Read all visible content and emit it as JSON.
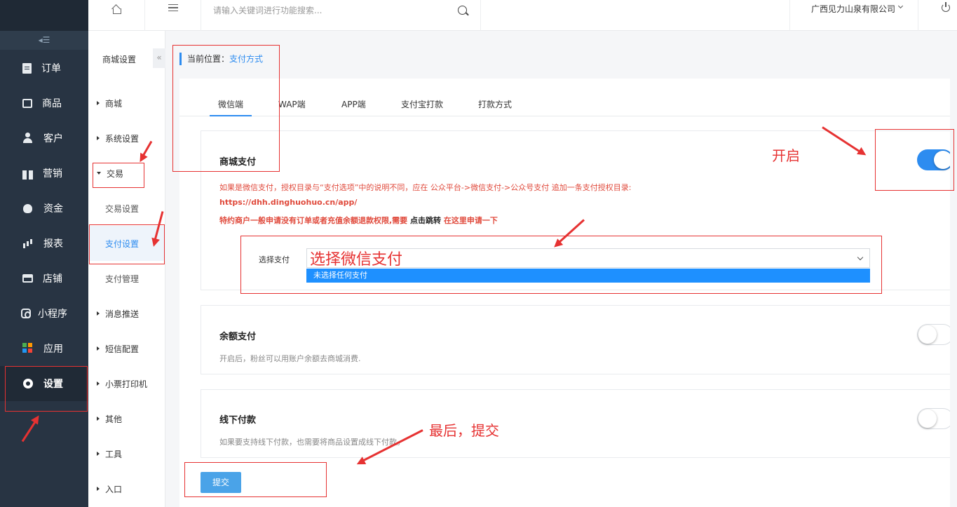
{
  "sidebar": {
    "collapse_glyph": "◂☰",
    "items": [
      {
        "label": "订单",
        "icon": "document-icon"
      },
      {
        "label": "商品",
        "icon": "bag-icon"
      },
      {
        "label": "客户",
        "icon": "user-icon"
      },
      {
        "label": "营销",
        "icon": "gift-icon"
      },
      {
        "label": "资金",
        "icon": "money-bag-icon"
      },
      {
        "label": "报表",
        "icon": "bar-chart-icon"
      },
      {
        "label": "店铺",
        "icon": "shop-icon"
      },
      {
        "label": "小程序",
        "icon": "mini-program-icon"
      },
      {
        "label": "应用",
        "icon": "apps-grid-icon"
      },
      {
        "label": "设置",
        "icon": "gear-icon"
      }
    ]
  },
  "topbar": {
    "search_placeholder": "请输入关键词进行功能搜索...",
    "company": "广西见力山泉有限公司"
  },
  "subnav": {
    "title": "商城设置",
    "collapse_glyph": "«",
    "items": [
      {
        "label": "商城"
      },
      {
        "label": "系统设置"
      },
      {
        "label": "交易"
      },
      {
        "label": "交易设置"
      },
      {
        "label": "支付设置"
      },
      {
        "label": "支付管理"
      },
      {
        "label": "消息推送"
      },
      {
        "label": "短信配置"
      },
      {
        "label": "小票打印机"
      },
      {
        "label": "其他"
      },
      {
        "label": "工具"
      },
      {
        "label": "入口"
      }
    ]
  },
  "breadcrumb": {
    "prefix": "当前位置：",
    "current": "支付方式"
  },
  "tabs": [
    "微信端",
    "WAP端",
    "APP端",
    "支付宝打款",
    "打款方式"
  ],
  "mall_pay": {
    "title": "商城支付",
    "note1": "如果是微信支付，授权目录与“支付选项”中的说明不同，应在 公众平台->微信支付->公众号支付 追加一条支付授权目录:",
    "url": "https://dhh.dinghuohuo.cn/app/",
    "note2": "特约商户一般申请没有订单或者充值余额退款权限,需要",
    "note2_link": "点击跳转",
    "note2_tail": "在这里申请一下",
    "select_label": "选择支付",
    "select_option": "未选择任何支付",
    "enabled": true
  },
  "balance_pay": {
    "title": "余额支付",
    "desc": "开启后，粉丝可以用账户余额去商城消费.",
    "enabled": false
  },
  "offline_pay": {
    "title": "线下付款",
    "desc": "如果要支持线下付款，也需要将商品设置成线下付款。",
    "enabled": false
  },
  "submit_label": "提交",
  "annotations": {
    "open": "开启",
    "choose_wechat": "选择微信支付",
    "finally_submit": "最后，提交"
  },
  "colors": {
    "sidebar_bg": "#283443",
    "accent": "#2d8cf0",
    "annotation": "#e63232",
    "warning_text": "#e04a3c"
  }
}
